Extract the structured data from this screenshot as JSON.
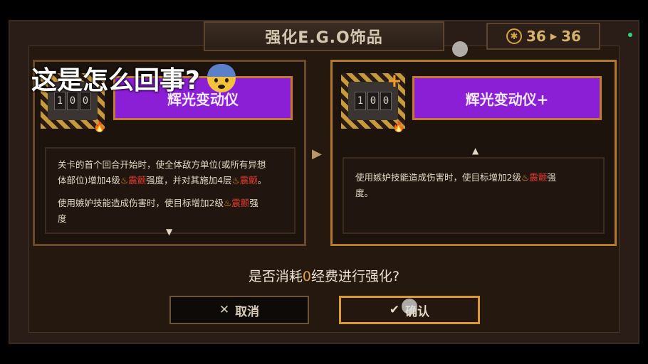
{
  "header": {
    "title": "强化E.G.O饰品",
    "level_from": "36",
    "level_to": "36",
    "level_icon": "sun-icon"
  },
  "overlay": {
    "caption": "这是怎么回事?",
    "emoji": "anxious-face-emoji"
  },
  "left_card": {
    "counter_digits": [
      "1",
      "0",
      "0"
    ],
    "name": "辉光变动仪",
    "desc_line1": "关卡的首个回合开始时，使全体敌方单位(或所有异想",
    "desc_line2_a": "体部位)增加4级",
    "desc_line2_kw": "震颤",
    "desc_line2_b": "强度，并对其施加4层",
    "desc_line2_kw2": "震颤",
    "desc_line2_c": "。",
    "desc_line3_a": "使用嫉妒技能造成伤害时，使目标增加2级",
    "desc_line3_kw": "震颤",
    "desc_line3_b": "强",
    "desc_line4": "度"
  },
  "right_card": {
    "counter_digits": [
      "1",
      "0",
      "0"
    ],
    "name": "辉光变动仪+",
    "desc_line1_a": "使用嫉妒技能造成伤害时，使目标增加2级",
    "desc_line1_kw": "震颤",
    "desc_line1_b": "强",
    "desc_line2": "度。"
  },
  "prompt": {
    "before": "是否消耗",
    "cost": "0",
    "after": "经费进行强化?"
  },
  "buttons": {
    "cancel_label": "取消",
    "confirm_label": "确认"
  },
  "colors": {
    "accent": "#d99a35",
    "name_box": "#8b1fd6",
    "keyword": "#e23b2f"
  }
}
